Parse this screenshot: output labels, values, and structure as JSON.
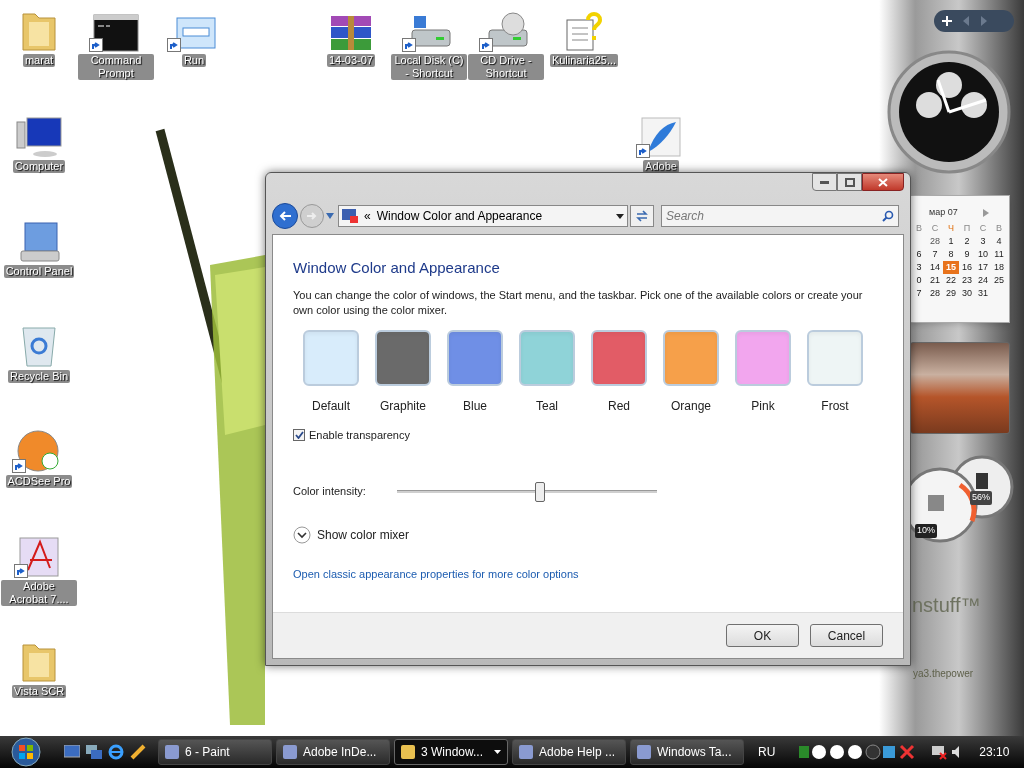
{
  "desktop_icons": [
    {
      "label": "marat",
      "kind": "folder",
      "shortcut": false
    },
    {
      "label": "Command Prompt",
      "kind": "console",
      "shortcut": true
    },
    {
      "label": "Run",
      "kind": "run",
      "shortcut": true
    },
    {
      "label": "14-03-07",
      "kind": "archive",
      "shortcut": false
    },
    {
      "label": "Local Disk (C) - Shortcut",
      "kind": "drive",
      "shortcut": true
    },
    {
      "label": "CD Drive - Shortcut",
      "kind": "dvd",
      "shortcut": true
    },
    {
      "label": "Kulinaria25...",
      "kind": "document",
      "shortcut": false
    },
    {
      "label": "Computer",
      "kind": "computer",
      "shortcut": false
    },
    {
      "label": "Control Panel",
      "kind": "control",
      "shortcut": false
    },
    {
      "label": "Recycle Bin",
      "kind": "recycle",
      "shortcut": false
    },
    {
      "label": "ACDSee Pro",
      "kind": "app",
      "shortcut": true
    },
    {
      "label": "Adobe Acrobat 7....",
      "kind": "pdf",
      "shortcut": true
    },
    {
      "label": "Vista SCR",
      "kind": "folder",
      "shortcut": false
    },
    {
      "label": "Adobe",
      "kind": "feather",
      "shortcut": true
    }
  ],
  "sidebar": {
    "calendar": {
      "month": "мар 07",
      "weekdays": [
        "В",
        "С",
        "Ч",
        "П",
        "С",
        "В"
      ],
      "weeks": [
        [
          {
            "day": "28",
            "today": false
          },
          {
            "day": "1",
            "today": false
          },
          {
            "day": "2",
            "today": false
          },
          {
            "day": "3",
            "today": false
          },
          {
            "day": "4",
            "today": false
          }
        ],
        [
          {
            "day": "6",
            "today": false
          },
          {
            "day": "7",
            "today": false
          },
          {
            "day": "8",
            "today": false
          },
          {
            "day": "9",
            "today": false
          },
          {
            "day": "10",
            "today": false
          },
          {
            "day": "11",
            "today": false
          }
        ],
        [
          {
            "day": "3",
            "today": false
          },
          {
            "day": "14",
            "today": false
          },
          {
            "day": "15",
            "today": true
          },
          {
            "day": "16",
            "today": false
          },
          {
            "day": "17",
            "today": false
          },
          {
            "day": "18",
            "today": false
          }
        ],
        [
          {
            "day": "0",
            "today": false
          },
          {
            "day": "21",
            "today": false
          },
          {
            "day": "22",
            "today": false
          },
          {
            "day": "23",
            "today": false
          },
          {
            "day": "24",
            "today": false
          },
          {
            "day": "25",
            "today": false
          }
        ],
        [
          {
            "day": "7",
            "today": false
          },
          {
            "day": "28",
            "today": false
          },
          {
            "day": "29",
            "today": false
          },
          {
            "day": "30",
            "today": false
          },
          {
            "day": "31",
            "today": false
          }
        ]
      ]
    },
    "gauges": [
      "10%",
      "56%"
    ],
    "brand": "nstuff™",
    "footer": "ya3.thepower"
  },
  "dialog": {
    "address": "Window Color and Appearance",
    "address_prefix": "«",
    "search": {
      "placeholder": "Search"
    },
    "heading": "Window Color and Appearance",
    "description": "You can change the color of windows, the Start menu, and the taskbar. Pick one of the available colors or create your own color using the color mixer.",
    "swatches": [
      {
        "label": "Default",
        "color": "#d8ecfb"
      },
      {
        "label": "Graphite",
        "color": "#6a6a6a"
      },
      {
        "label": "Blue",
        "color": "#6f8fe6"
      },
      {
        "label": "Teal",
        "color": "#8fd3d8"
      },
      {
        "label": "Red",
        "color": "#e25c66"
      },
      {
        "label": "Orange",
        "color": "#f6a04a"
      },
      {
        "label": "Pink",
        "color": "#f2a6ee"
      },
      {
        "label": "Frost",
        "color": "#eef5f5"
      }
    ],
    "transparency": {
      "label": "Enable transparency",
      "checked": true
    },
    "intensity": {
      "label": "Color intensity:",
      "level": 0.55
    },
    "mixer": {
      "label": "Show color mixer",
      "expanded": false
    },
    "link": "Open classic appearance properties for more color options",
    "buttons": [
      "OK",
      "Cancel"
    ]
  },
  "taskbar": {
    "tasks": [
      {
        "label": "6 - Paint",
        "selected": false,
        "group": false
      },
      {
        "label": "Adobe InDe...",
        "selected": false,
        "group": false
      },
      {
        "label": "3 Window...",
        "selected": true,
        "group": true
      },
      {
        "label": "Adobe Help ...",
        "selected": false,
        "group": false
      },
      {
        "label": "Windows Ta...",
        "selected": false,
        "group": false
      }
    ],
    "language": "RU",
    "clock": "23:10"
  }
}
